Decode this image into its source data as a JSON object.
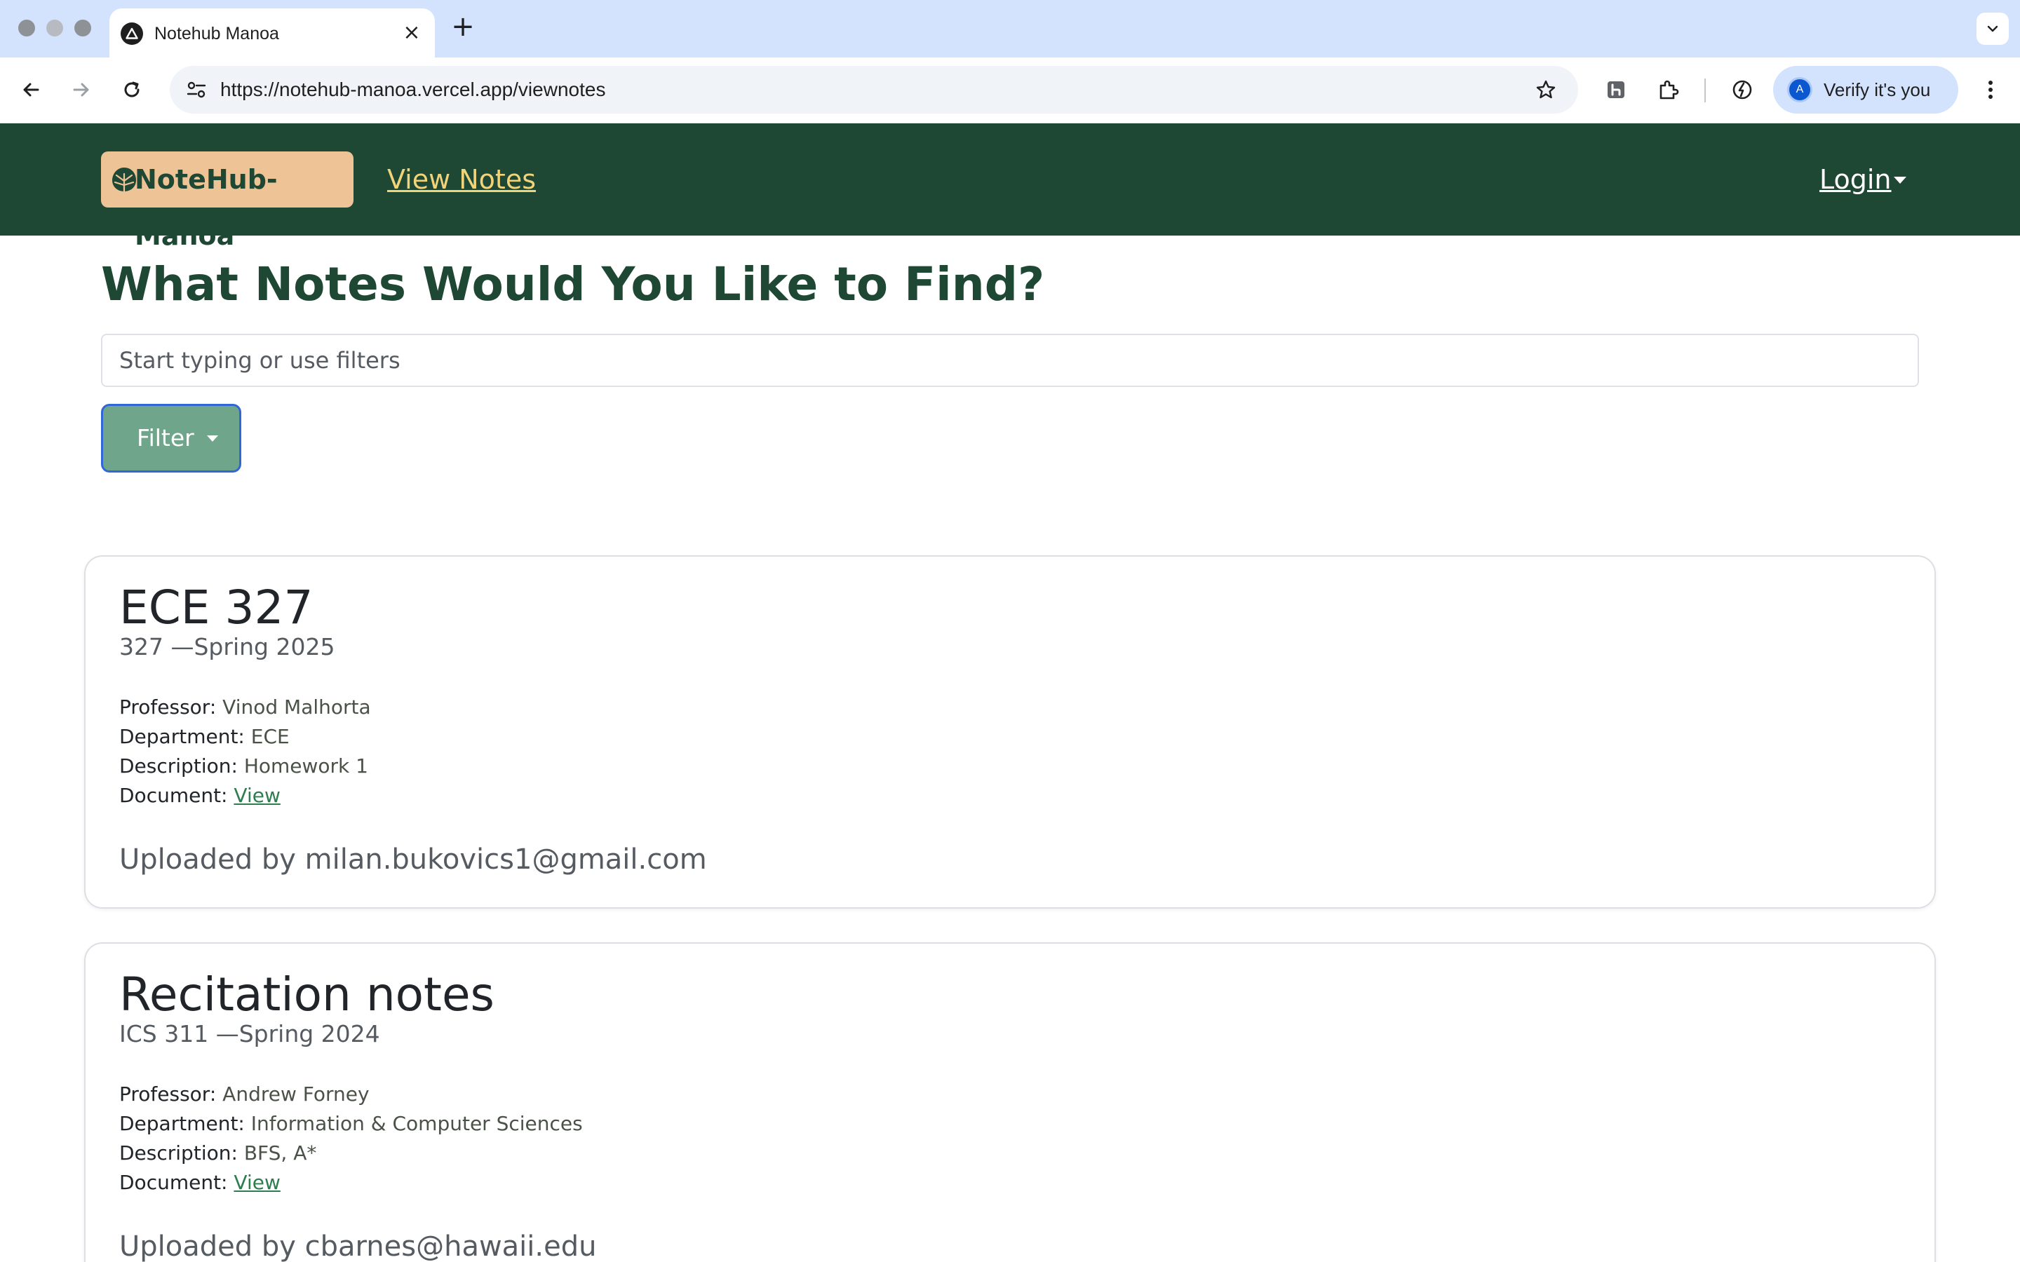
{
  "browser": {
    "tab_title": "Notehub Manoa",
    "new_tab_glyph": "+",
    "close_glyph": "×",
    "url": "https://notehub-manoa.vercel.app/viewnotes",
    "profile_label": "Verify it's you",
    "profile_initial": "A"
  },
  "navbar": {
    "brand": "NoteHub-Mānoa",
    "view_notes": "View Notes",
    "login": "Login",
    "bg_color": "#1e4734",
    "brand_bg": "#eec497",
    "link_color": "#f1d37a"
  },
  "main": {
    "title": "What Notes Would You Like to Find?",
    "search_placeholder": "Start typing or use filters",
    "filter_label": "Filter"
  },
  "labels": {
    "professor": "Professor:",
    "department": "Department:",
    "description": "Description:",
    "document": "Document:"
  },
  "notes": [
    {
      "title": "ECE 327",
      "subtitle": "327 —Spring 2025",
      "professor": "Vinod Malhorta",
      "department": "ECE",
      "description": "Homework 1",
      "document_link": "View",
      "uploaded": "Uploaded by milan.bukovics1@gmail.com"
    },
    {
      "title": "Recitation notes",
      "subtitle": "ICS 311 —Spring 2024",
      "professor": "Andrew Forney",
      "department": "Information & Computer Sciences",
      "description": "BFS, A*",
      "document_link": "View",
      "uploaded": "Uploaded by cbarnes@hawaii.edu"
    }
  ],
  "icons": {
    "favicon": "triangle-favicon-icon",
    "back": "back-arrow-icon",
    "forward": "forward-arrow-icon",
    "reload": "reload-icon",
    "site_info": "tune-icon",
    "bookmark": "star-icon",
    "extension_h": "honey-extension-icon",
    "extensions": "puzzle-icon",
    "performance": "speedometer-icon",
    "menu": "kebab-menu-icon",
    "brand": "monstera-leaf-icon"
  }
}
